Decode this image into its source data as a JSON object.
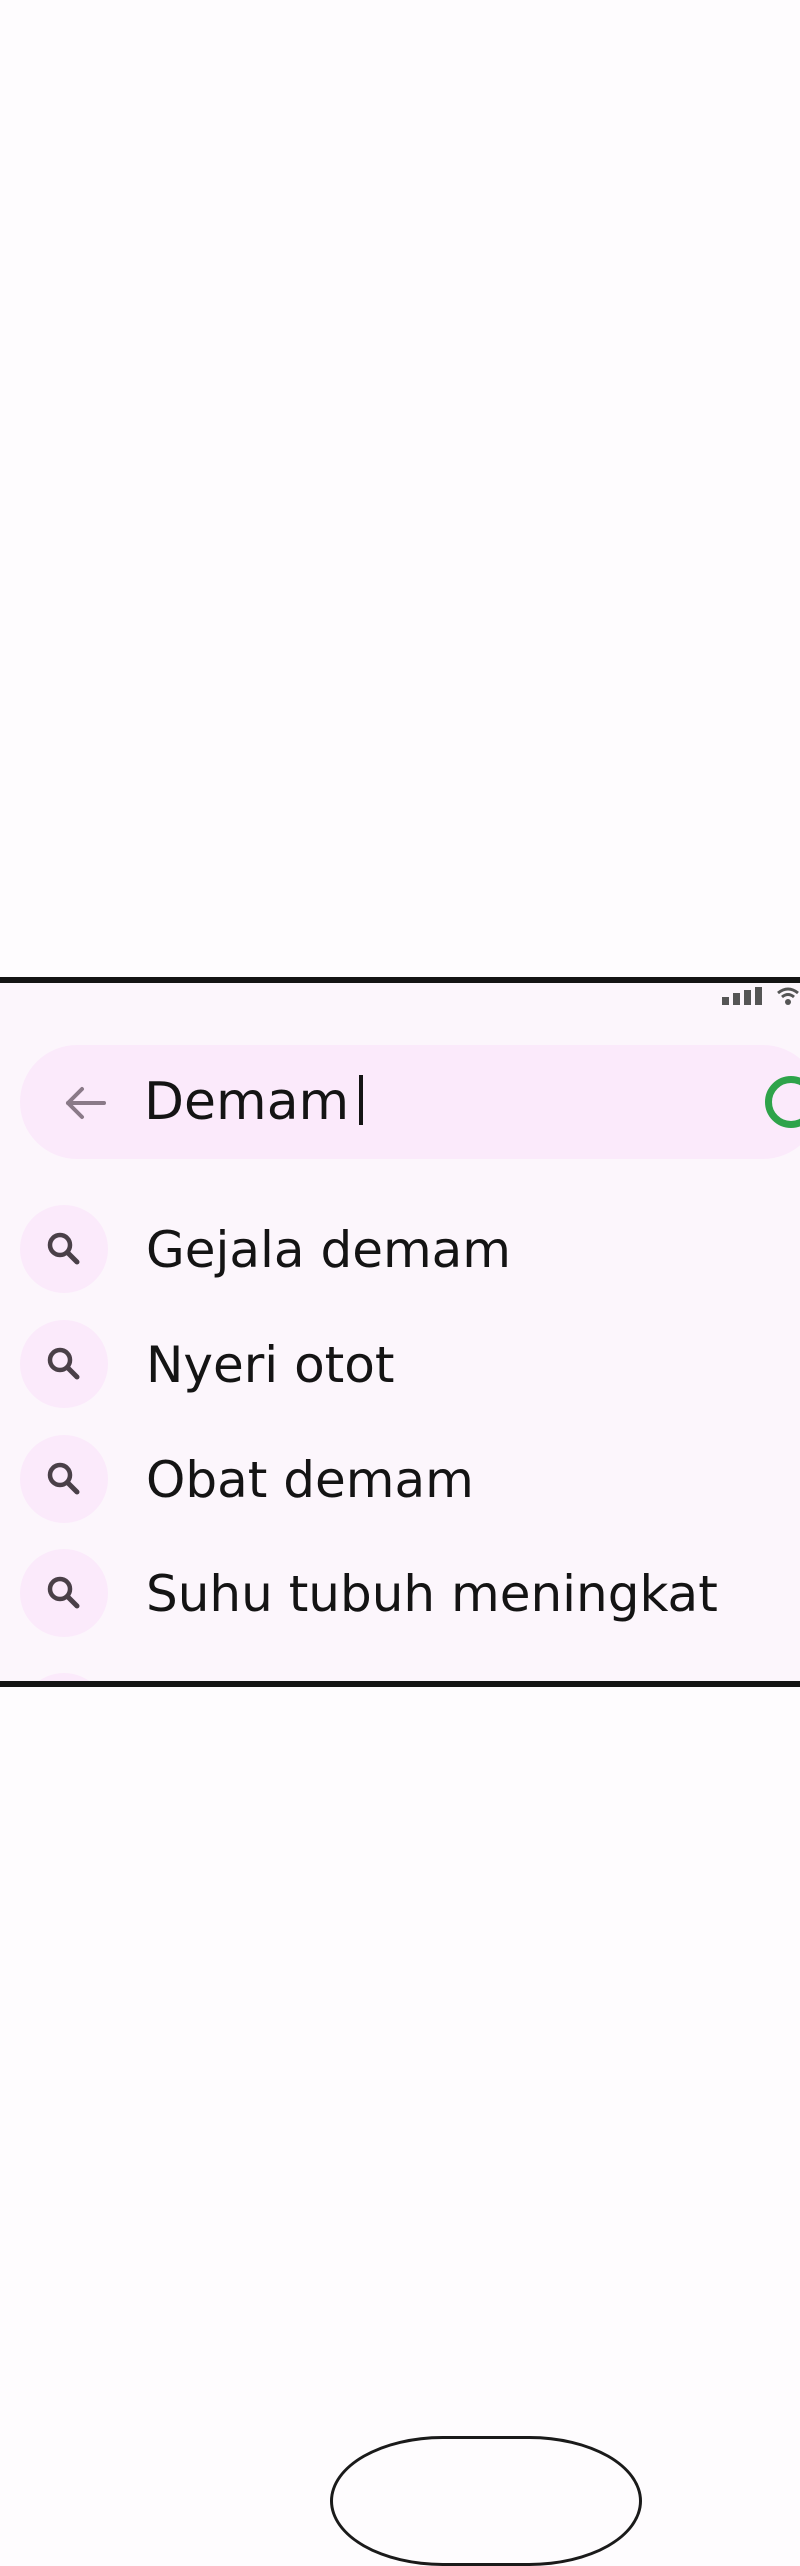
{
  "search": {
    "query": "Demam",
    "back_icon": "arrow-left-icon",
    "action_icon": "green-ring-icon"
  },
  "suggestions": [
    {
      "label": "Gejala demam",
      "icon": "search-icon"
    },
    {
      "label": "Nyeri otot",
      "icon": "search-icon"
    },
    {
      "label": "Obat demam",
      "icon": "search-icon"
    },
    {
      "label": "Suhu tubuh meningkat",
      "icon": "search-icon"
    }
  ],
  "status_bar": {
    "icons": [
      "signal-icon",
      "wifi-icon"
    ]
  },
  "colors": {
    "accent_pink": "#fbeafb",
    "background": "#fcf6fc",
    "ring_green": "#2ea34a",
    "text": "#141414"
  }
}
